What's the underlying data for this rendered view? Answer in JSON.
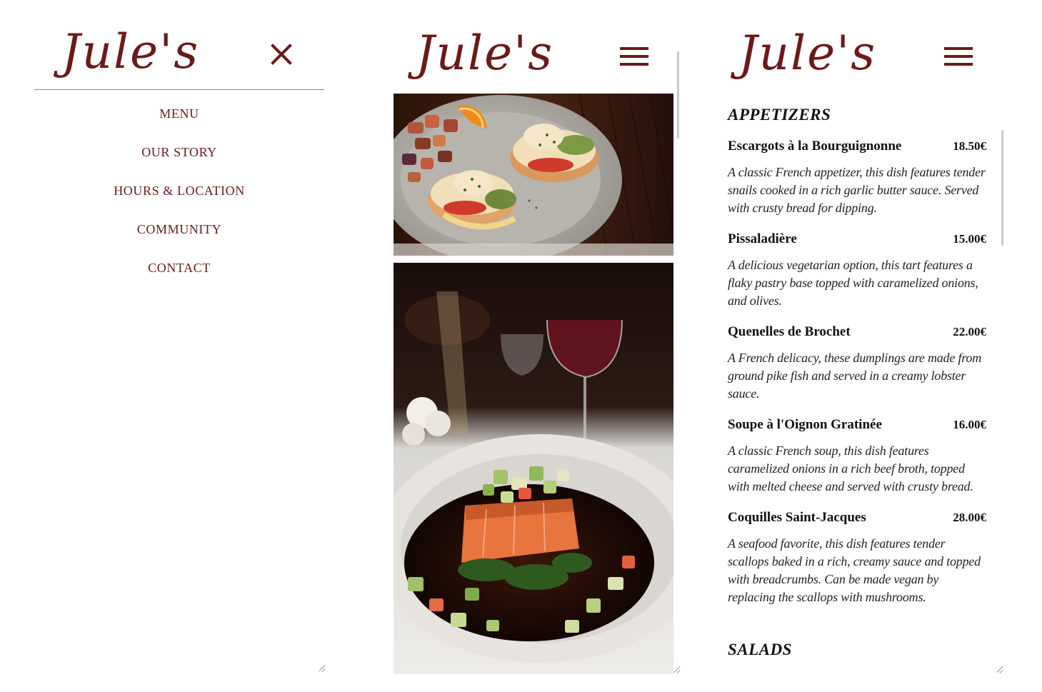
{
  "brand": {
    "logo_text": "Jule's",
    "color": "#6b1a1a"
  },
  "nav": {
    "items": [
      {
        "label": "MENU"
      },
      {
        "label": "OUR STORY"
      },
      {
        "label": "HOURS & LOCATION"
      },
      {
        "label": "COMMUNITY"
      },
      {
        "label": "CONTACT"
      }
    ]
  },
  "photos": {
    "images": [
      {
        "subject": "eggs benedict with avocado, roasted potatoes and orange slice"
      },
      {
        "subject": "seared salmon over spinach with cucumber salsa and glass of red wine"
      }
    ]
  },
  "menu": {
    "sections": [
      {
        "title": "APPETIZERS",
        "items": [
          {
            "name": "Escargots à la Bourguignonne",
            "price": "18.50€",
            "description": "A classic French appetizer, this dish features tender snails cooked in a rich garlic butter sauce. Served with crusty bread for dipping."
          },
          {
            "name": "Pissaladière",
            "price": "15.00€",
            "description": "A delicious vegetarian option, this tart features a flaky pastry base topped with caramelized onions, and olives."
          },
          {
            "name": "Quenelles de Brochet",
            "price": "22.00€",
            "description": "A French delicacy, these dumplings are made from ground pike fish and served in a creamy lobster sauce."
          },
          {
            "name": "Soupe à l'Oignon Gratinée",
            "price": "16.00€",
            "description": "A classic French soup, this dish features caramelized onions in a rich beef broth, topped with melted cheese and served with crusty bread."
          },
          {
            "name": "Coquilles Saint-Jacques",
            "price": "28.00€",
            "description": "A seafood favorite, this dish features tender scallops baked in a rich, creamy sauce and topped with breadcrumbs. Can be made vegan by replacing the scallops with mushrooms."
          }
        ]
      },
      {
        "title": "SALADS"
      }
    ]
  }
}
